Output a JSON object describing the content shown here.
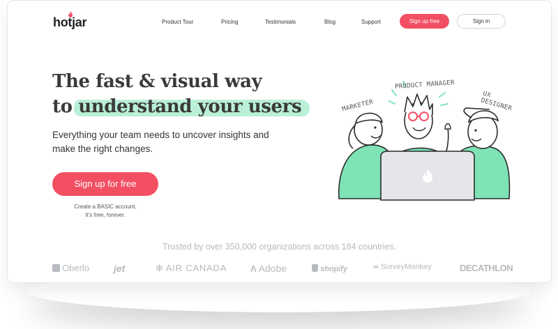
{
  "header": {
    "logo": "hotjar",
    "nav": [
      "Product Tour",
      "Pricing",
      "Testimonials",
      "Blog",
      "Support"
    ],
    "signup_label": "Sign up free",
    "signin_label": "Sign in"
  },
  "hero": {
    "headline_line1": "The fast & visual way",
    "headline_line2_prefix": "to",
    "headline_highlight": "understand your users",
    "subcopy": "Everything your team needs to uncover insights and make the right changes.",
    "cta_label": "Sign up for free",
    "cta_note_line1": "Create a BASIC account.",
    "cta_note_line2": "It's free, forever."
  },
  "illustration": {
    "roles": [
      "MARKETER",
      "PRODUCT MANAGER",
      "UX DESIGNER"
    ]
  },
  "trust": {
    "text": "Trusted by over 350,000 organizations across 184 countries.",
    "logos": [
      "Oberlo",
      "jet",
      "AIR CANADA",
      "Adobe",
      "shopify",
      "SurveyMonkey",
      "DECATHLON"
    ]
  },
  "colors": {
    "accent": "#f24f63",
    "highlight": "#7fe3b6",
    "illustration_green": "#7fe3b6"
  }
}
